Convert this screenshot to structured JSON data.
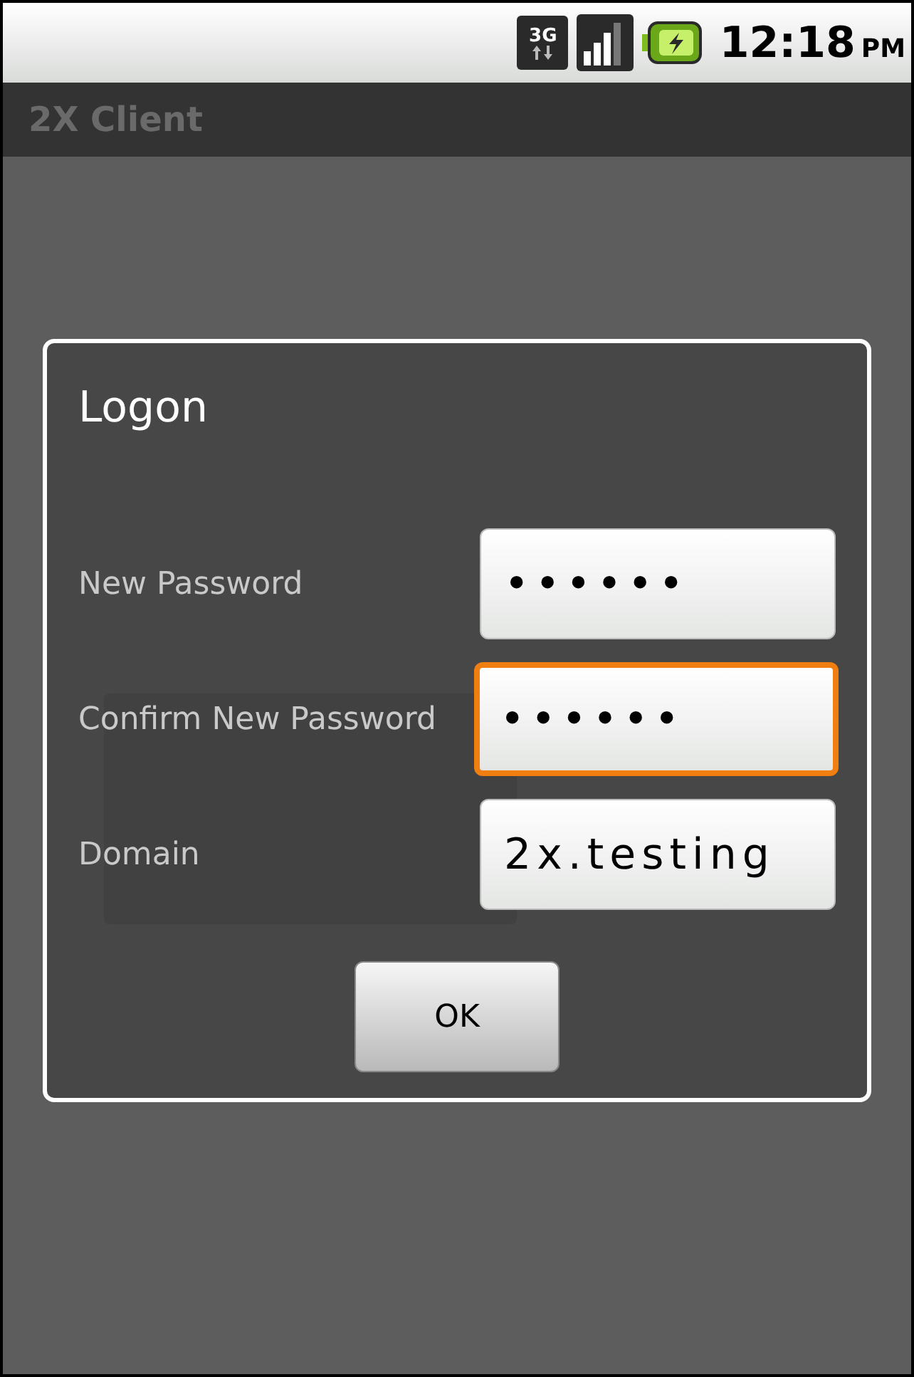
{
  "status_bar": {
    "network": "3G",
    "time": "12:18",
    "meridiem": "PM"
  },
  "app_bar": {
    "title": "2X Client"
  },
  "dialog": {
    "title": "Logon",
    "fields": [
      {
        "label": "New Password",
        "value": "••••••",
        "focused": false
      },
      {
        "label": "Confirm New Password",
        "value": "••••••",
        "focused": true
      },
      {
        "label": "Domain",
        "value": "2x.testing",
        "focused": false
      }
    ],
    "button": "OK"
  }
}
